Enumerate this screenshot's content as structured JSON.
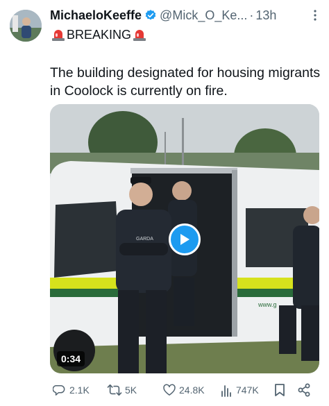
{
  "author": {
    "display_name": "MichaeloKeeffe",
    "handle": "@Mick_O_Ke...",
    "separator": "·",
    "time": "13h"
  },
  "tweet": {
    "breaking_label": "BREAKING",
    "text": "The building designated for housing migrants in Coolock is currently on fire."
  },
  "media": {
    "duration": "0:34",
    "van_text": "www.g",
    "officer_text": "GARDA"
  },
  "actions": {
    "replies": "2.1K",
    "retweets": "5K",
    "likes": "24.8K",
    "views": "747K"
  },
  "colors": {
    "accent": "#1d9bf0",
    "text": "#0f1419",
    "secondary": "#536471"
  },
  "icons": [
    "verified-badge-icon",
    "siren-icon",
    "more-icon",
    "play-icon",
    "reply-icon",
    "retweet-icon",
    "like-icon",
    "views-icon",
    "bookmark-icon",
    "share-icon"
  ]
}
